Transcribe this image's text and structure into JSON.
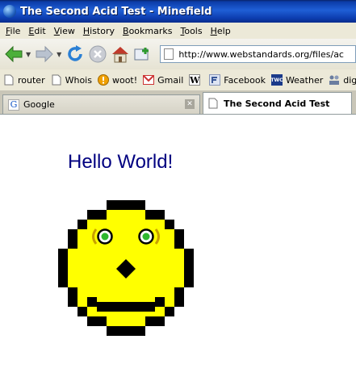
{
  "window": {
    "title": "The Second Acid Test - Minefield"
  },
  "menu": [
    {
      "key": "F",
      "rest": "ile"
    },
    {
      "key": "E",
      "rest": "dit"
    },
    {
      "key": "V",
      "rest": "iew"
    },
    {
      "key": "H",
      "rest": "istory"
    },
    {
      "key": "B",
      "rest": "ookmarks"
    },
    {
      "key": "T",
      "rest": "ools"
    },
    {
      "key": "H",
      "rest": "elp"
    }
  ],
  "navigation": {
    "url": "http://www.webstandards.org/files/ac"
  },
  "bookmarks": [
    {
      "label": "router",
      "icon": "page-icon"
    },
    {
      "label": "Whois",
      "icon": "page-icon"
    },
    {
      "label": "woot!",
      "icon": "woot-icon"
    },
    {
      "label": "Gmail",
      "icon": "gmail-icon"
    },
    {
      "label": "",
      "icon": "wikipedia-icon",
      "glyph": "W"
    },
    {
      "label": "Facebook",
      "icon": "facebook-icon"
    },
    {
      "label": "Weather",
      "icon": "weather-icon",
      "glyph": "TWC"
    },
    {
      "label": "digg",
      "icon": "digg-icon"
    }
  ],
  "tabs": [
    {
      "label": "Google",
      "active": false,
      "icon_glyph": "G"
    },
    {
      "label": "The Second Acid Test",
      "active": true
    }
  ],
  "page": {
    "heading": "Hello World!"
  },
  "colors": {
    "face": "#ffff00",
    "outline": "#000000",
    "eye_ring": "#000000",
    "iris": "#2eb82e",
    "heading": "#000080",
    "brow": "#c8a000"
  }
}
